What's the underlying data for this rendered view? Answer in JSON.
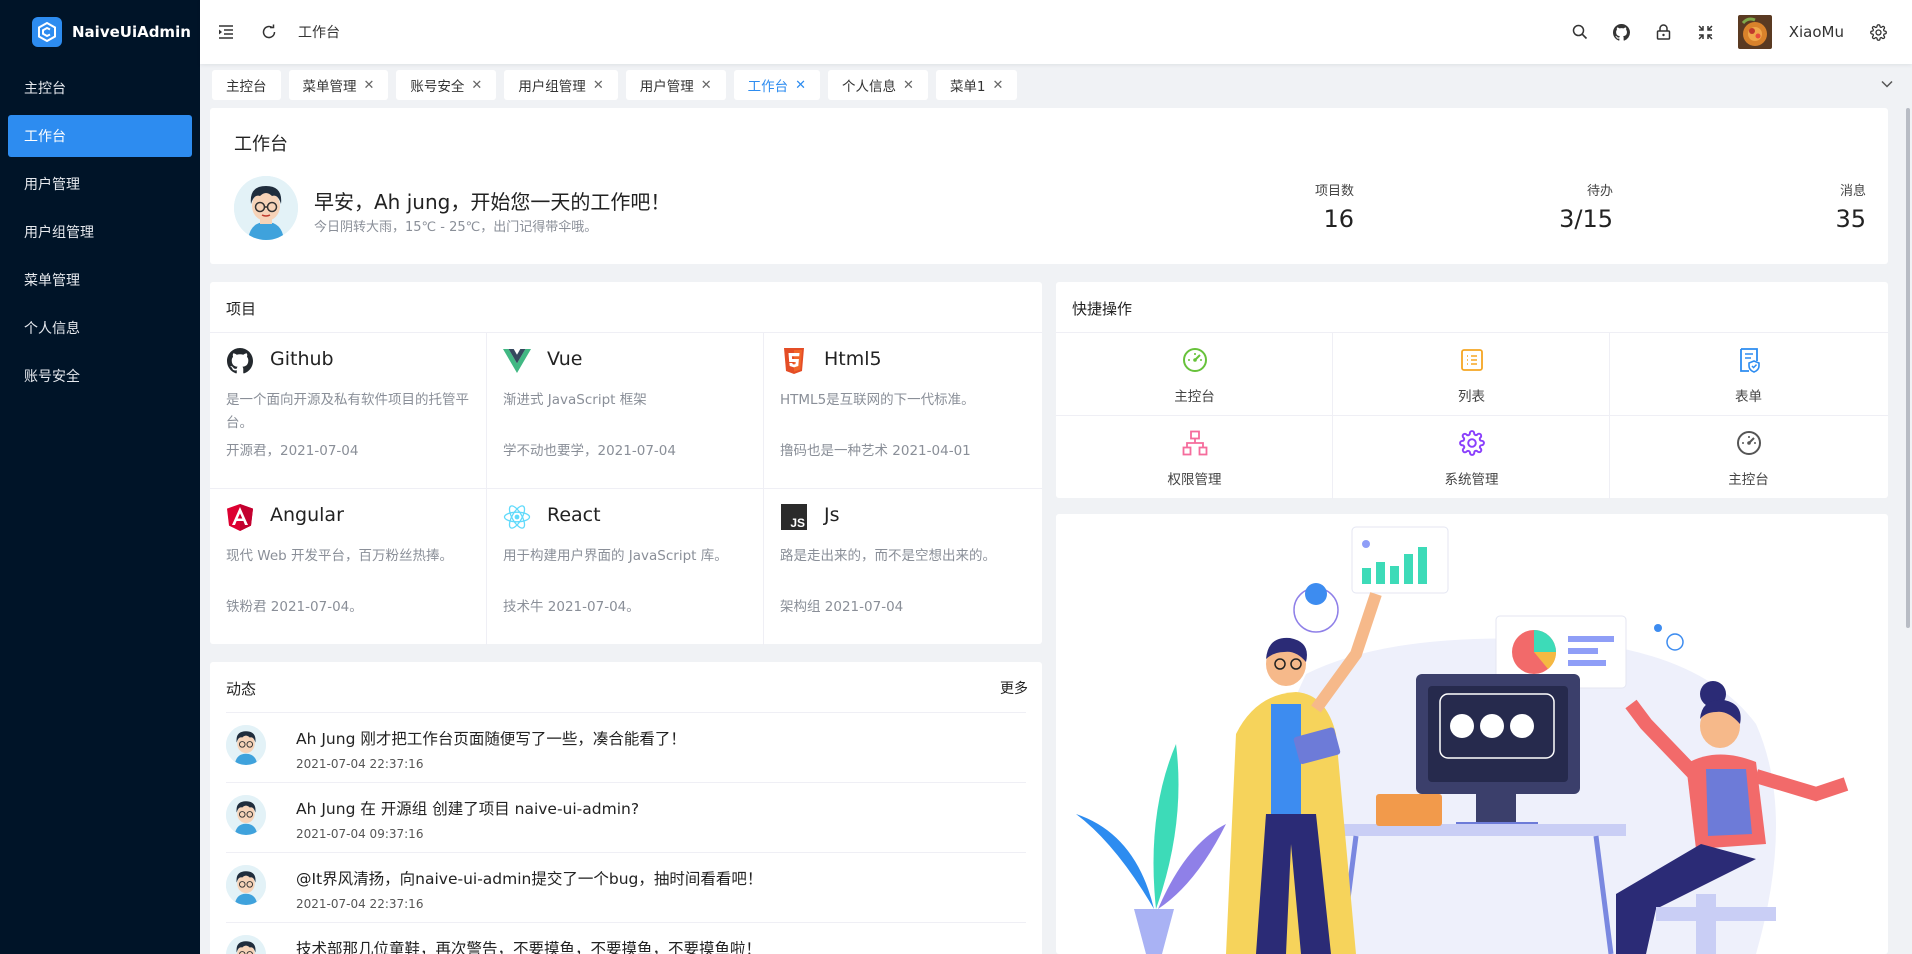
{
  "app": {
    "name": "NaiveUiAdmin"
  },
  "sidebar": {
    "items": [
      {
        "label": "主控台"
      },
      {
        "label": "工作台",
        "active": true
      },
      {
        "label": "用户管理"
      },
      {
        "label": "用户组管理"
      },
      {
        "label": "菜单管理"
      },
      {
        "label": "个人信息"
      },
      {
        "label": "账号安全"
      }
    ]
  },
  "header": {
    "breadcrumb": "工作台",
    "username": "XiaoMu",
    "icons": [
      "menu-fold-icon",
      "refresh-icon",
      "search-icon",
      "github-icon",
      "lock-icon",
      "fullscreen-icon",
      "gear-icon"
    ]
  },
  "tabs": [
    {
      "label": "主控台",
      "closable": false
    },
    {
      "label": "菜单管理",
      "closable": true
    },
    {
      "label": "账号安全",
      "closable": true
    },
    {
      "label": "用户组管理",
      "closable": true
    },
    {
      "label": "用户管理",
      "closable": true
    },
    {
      "label": "工作台",
      "closable": true,
      "active": true
    },
    {
      "label": "个人信息",
      "closable": true
    },
    {
      "label": "菜单1",
      "closable": true
    }
  ],
  "welcome": {
    "title": "工作台",
    "greeting": "早安，Ah jung，开始您一天的工作吧！",
    "weather": "今日阴转大雨，15℃ - 25℃，出门记得带伞哦。",
    "stats": [
      {
        "label": "项目数",
        "value": "16"
      },
      {
        "label": "待办",
        "value": "3/15"
      },
      {
        "label": "消息",
        "value": "35"
      }
    ]
  },
  "projects": {
    "title": "项目",
    "items": [
      {
        "name": "Github",
        "icon": "github-icon",
        "desc": "是一个面向开源及私有软件项目的托管平台。",
        "meta": "开源君，2021-07-04"
      },
      {
        "name": "Vue",
        "icon": "vue-icon",
        "desc": "渐进式 JavaScript 框架",
        "meta": "学不动也要学，2021-07-04"
      },
      {
        "name": "Html5",
        "icon": "html5-icon",
        "desc": "HTML5是互联网的下一代标准。",
        "meta": "撸码也是一种艺术 2021-04-01"
      },
      {
        "name": "Angular",
        "icon": "angular-icon",
        "desc": "现代 Web 开发平台，百万粉丝热捧。",
        "meta": "铁粉君 2021-07-04。"
      },
      {
        "name": "React",
        "icon": "react-icon",
        "desc": "用于构建用户界面的 JavaScript 库。",
        "meta": "技术牛 2021-07-04。"
      },
      {
        "name": "Js",
        "icon": "js-icon",
        "desc": "路是走出来的，而不是空想出来的。",
        "meta": "架构组 2021-07-04"
      }
    ]
  },
  "dynamic": {
    "title": "动态",
    "more": "更多",
    "items": [
      {
        "text": "Ah Jung 刚才把工作台页面随便写了一些，凑合能看了！",
        "time": "2021-07-04 22:37:16"
      },
      {
        "text": "Ah Jung 在 开源组 创建了项目 naive-ui-admin?",
        "time": "2021-07-04 09:37:16"
      },
      {
        "text": "@It界风清扬，向naive-ui-admin提交了一个bug，抽时间看看吧！",
        "time": "2021-07-04 22:37:16"
      },
      {
        "text": "技术部那几位童鞋，再次警告，不要摸鱼，不要摸鱼，不要摸鱼啦！",
        "time": ""
      }
    ]
  },
  "quick": {
    "title": "快捷操作",
    "items": [
      {
        "label": "主控台",
        "icon": "dashboard-icon",
        "color": "#67c23a"
      },
      {
        "label": "列表",
        "icon": "list-icon",
        "color": "#f5a623"
      },
      {
        "label": "表单",
        "icon": "form-icon",
        "color": "#2d8cf0"
      },
      {
        "label": "权限管理",
        "icon": "org-tree-icon",
        "color": "#f56c9c"
      },
      {
        "label": "系统管理",
        "icon": "gear-icon",
        "color": "#8a3ffc"
      },
      {
        "label": "主控台",
        "icon": "dashboard-icon",
        "color": "#555555"
      }
    ]
  },
  "theme": {
    "primary": "#2d8cf0",
    "sidebar": "#001428"
  }
}
